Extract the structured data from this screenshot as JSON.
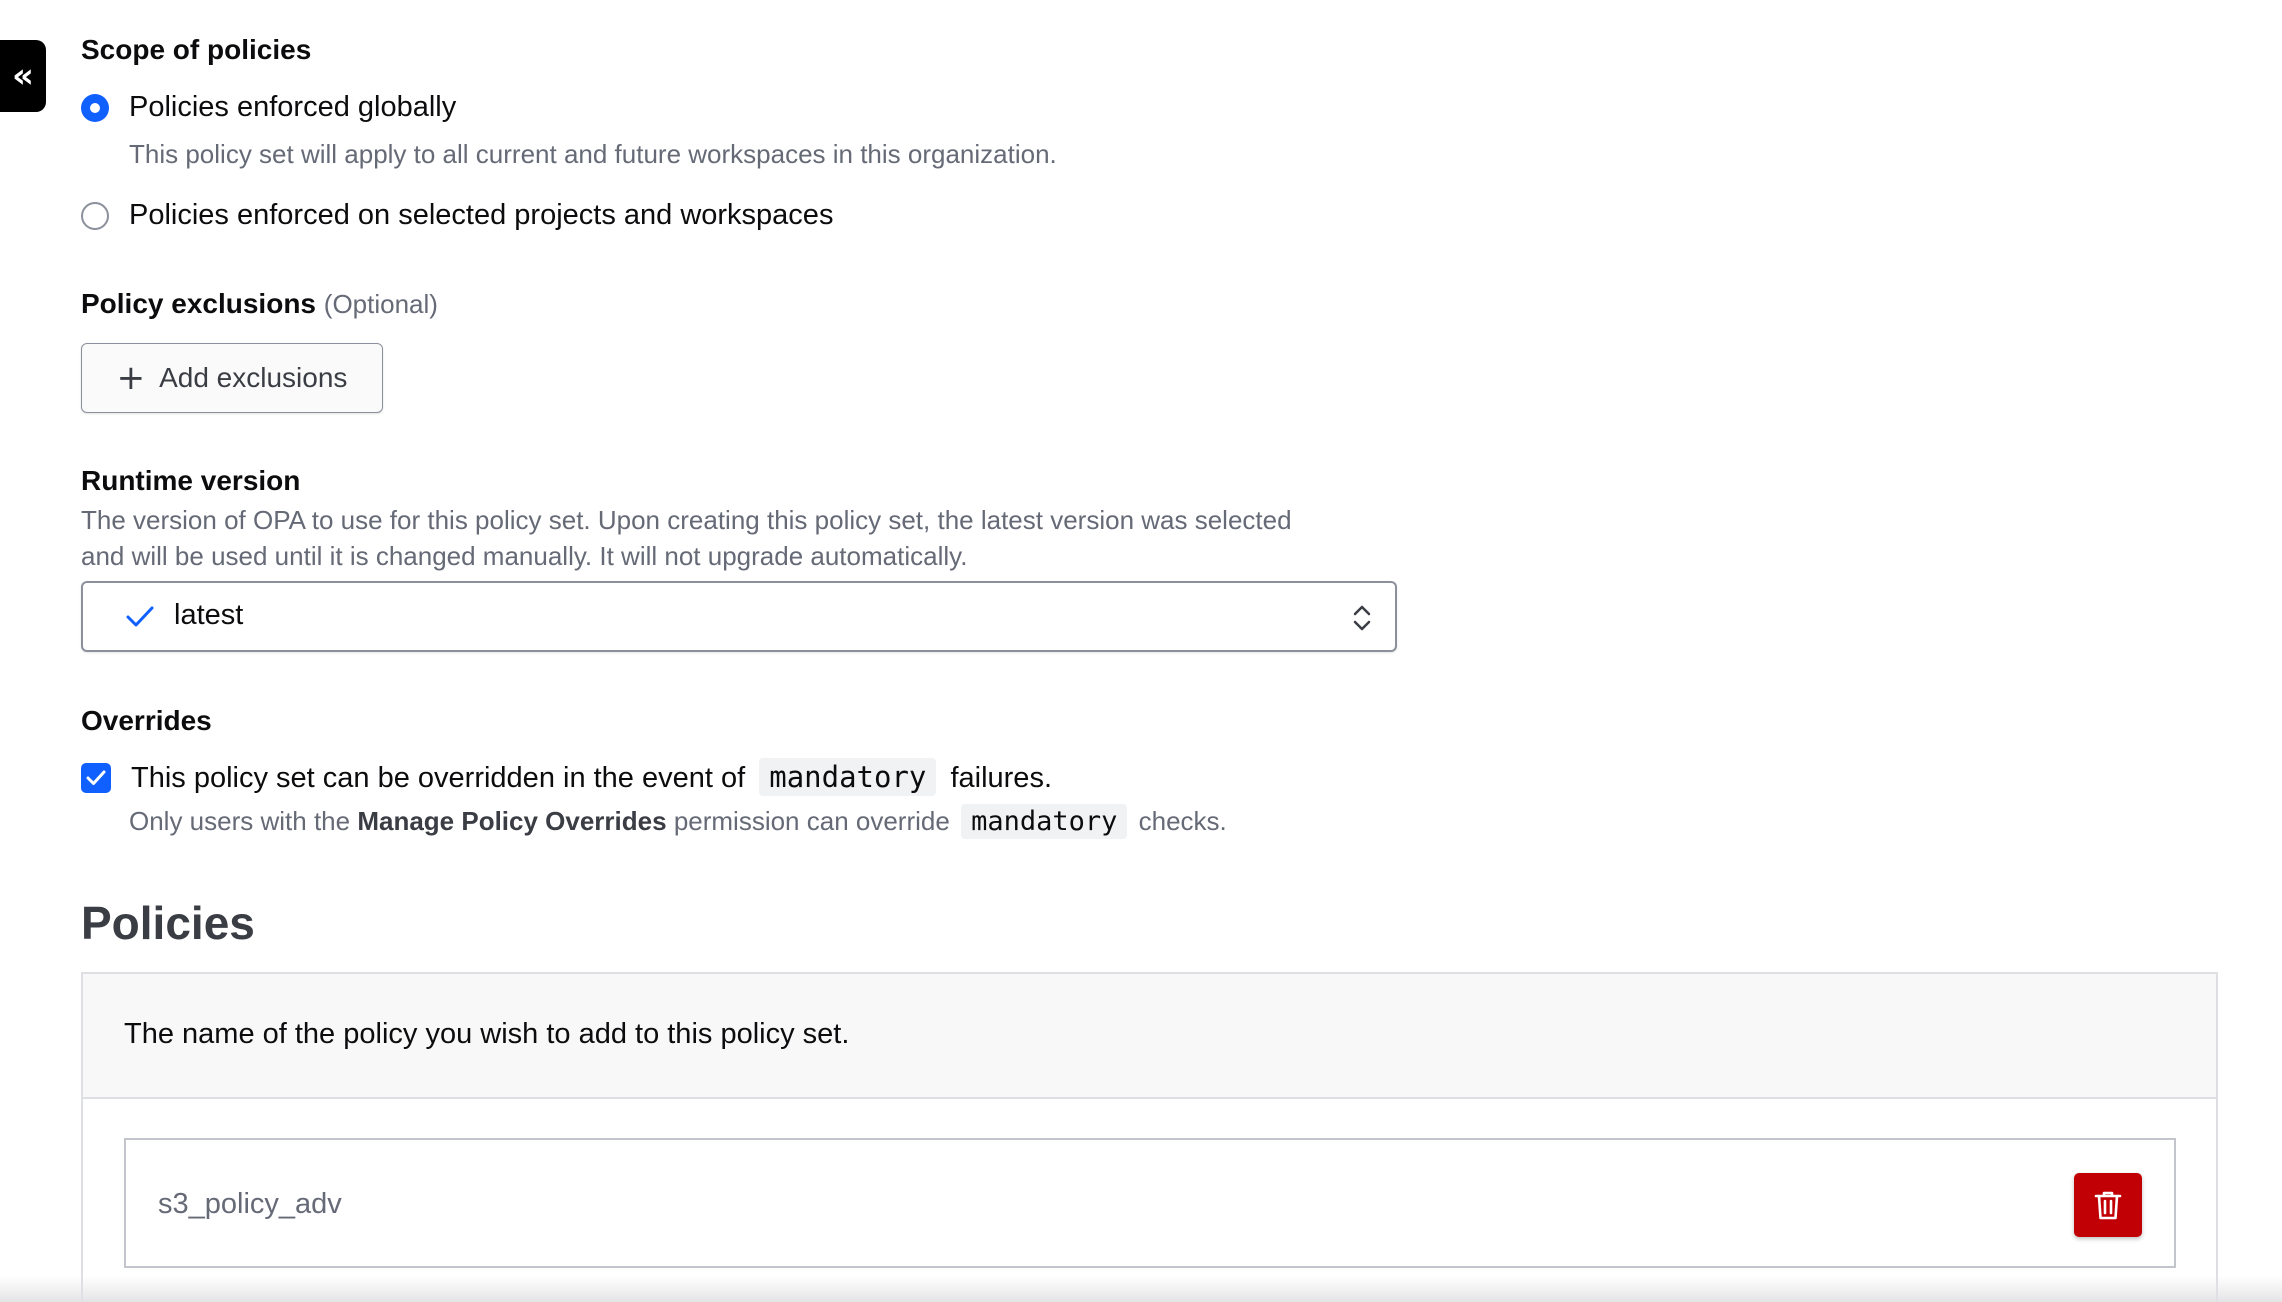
{
  "sidebar": {
    "collapse_glyph": "«",
    "collapse_icon": "double-chevron-left-icon"
  },
  "scope": {
    "label": "Scope of policies",
    "options": [
      {
        "label": "Policies enforced globally",
        "description": "This policy set will apply to all current and future workspaces in this organization.",
        "selected": true
      },
      {
        "label": "Policies enforced on selected projects and workspaces",
        "selected": false
      }
    ]
  },
  "exclusions": {
    "label": "Policy exclusions",
    "optional": "(Optional)",
    "add_button": "Add exclusions",
    "add_icon": "plus-icon"
  },
  "runtime": {
    "label": "Runtime version",
    "description_line1": "The version of OPA to use for this policy set. Upon creating this policy set, the latest version was selected",
    "description_line2": "and will be used until it is changed manually. It will not upgrade automatically.",
    "selected_value": "latest",
    "check_icon": "check-icon",
    "chevron_icon": "chevron-up-down-icon"
  },
  "overrides": {
    "label": "Overrides",
    "checked": true,
    "checkbox_text_before": "This policy set can be overridden in the event of",
    "checkbox_code": "mandatory",
    "checkbox_text_after": "failures.",
    "helper_before": "Only users with the",
    "helper_strong": "Manage Policy Overrides",
    "helper_middle": "permission can override",
    "helper_code": "mandatory",
    "helper_after": "checks."
  },
  "policies": {
    "heading": "Policies",
    "description": "The name of the policy you wish to add to this policy set.",
    "items": [
      {
        "name": "s3_policy_adv",
        "delete_icon": "trash-icon"
      }
    ]
  },
  "colors": {
    "accent": "#1060ff",
    "danger": "#c00005",
    "muted_text": "#656a76",
    "border": "#8c909c"
  }
}
